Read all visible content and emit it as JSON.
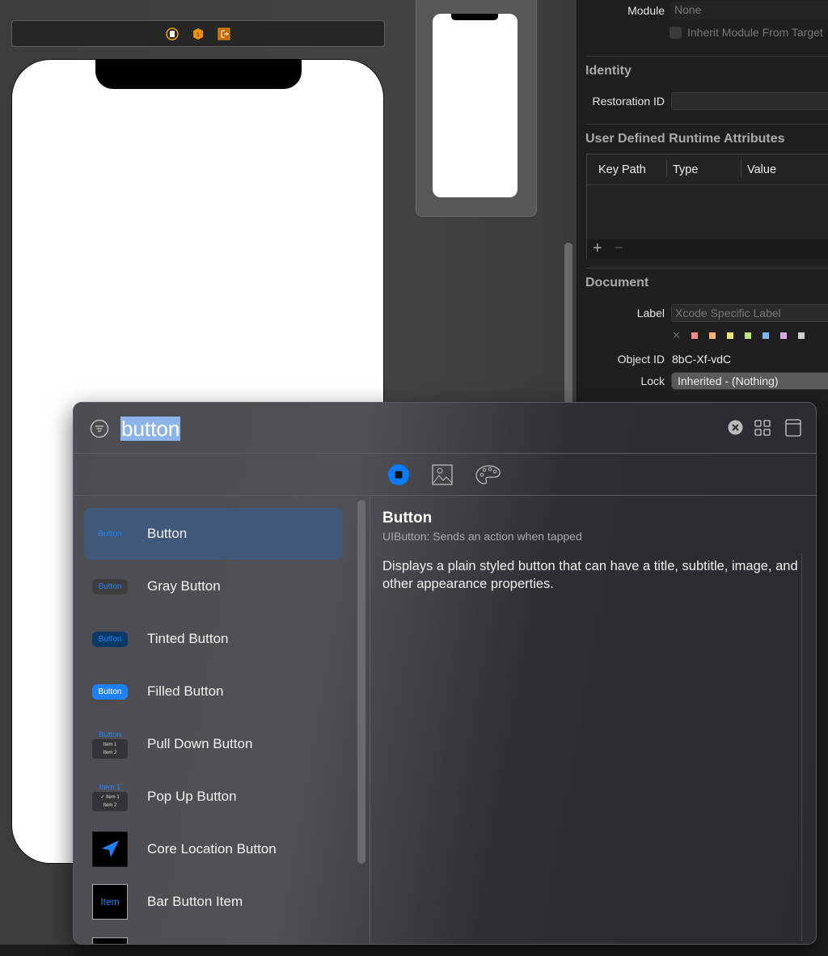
{
  "inspector": {
    "module_label": "Module",
    "module_value": "None",
    "inherit_label": "Inherit Module From Target",
    "identity_title": "Identity",
    "restoration_label": "Restoration ID",
    "restoration_value": "",
    "udra_title": "User Defined Runtime Attributes",
    "columns": [
      "Key Path",
      "Type",
      "Value"
    ],
    "add": "+",
    "remove": "−",
    "document_title": "Document",
    "label_label": "Label",
    "label_placeholder": "Xcode Specific Label",
    "label_colors": [
      "#f08a8a",
      "#f5b46a",
      "#f3e47a",
      "#c4e27a",
      "#7ab8f0",
      "#d9a8e8",
      "#cfcfcf"
    ],
    "clear_glyph": "✕",
    "object_id_label": "Object ID",
    "object_id": "8bC-Xf-vdC",
    "lock_label": "Lock",
    "lock_value": "Inherited - (Nothing)"
  },
  "library": {
    "search_value": "button",
    "tabs": [
      "objects-icon",
      "media-icon",
      "colors-icon"
    ],
    "items": [
      {
        "name": "Button",
        "thumb": "Button",
        "style": "plain",
        "selected": true
      },
      {
        "name": "Gray Button",
        "thumb": "Button",
        "style": "gray"
      },
      {
        "name": "Tinted Button",
        "thumb": "Button",
        "style": "tinted"
      },
      {
        "name": "Filled Button",
        "thumb": "Button",
        "style": "filled"
      },
      {
        "name": "Pull Down Button",
        "thumb": "Button",
        "menu": [
          "Item 1",
          "Item 2"
        ],
        "style": "pulldown"
      },
      {
        "name": "Pop Up Button",
        "thumb": "Item 1",
        "menu": [
          "✓ Item 1",
          "Item 2"
        ],
        "style": "popup"
      },
      {
        "name": "Core Location Button",
        "style": "location"
      },
      {
        "name": "Bar Button Item",
        "thumb": "Item",
        "style": "bar"
      }
    ],
    "detail": {
      "title": "Button",
      "subtitle": "UIButton: Sends an action when tapped",
      "description": "Displays a plain styled button that can have a title, subtitle, image, and other appearance properties."
    }
  },
  "colors": {
    "accent": "#0a7aff",
    "selection": "#40597a"
  }
}
